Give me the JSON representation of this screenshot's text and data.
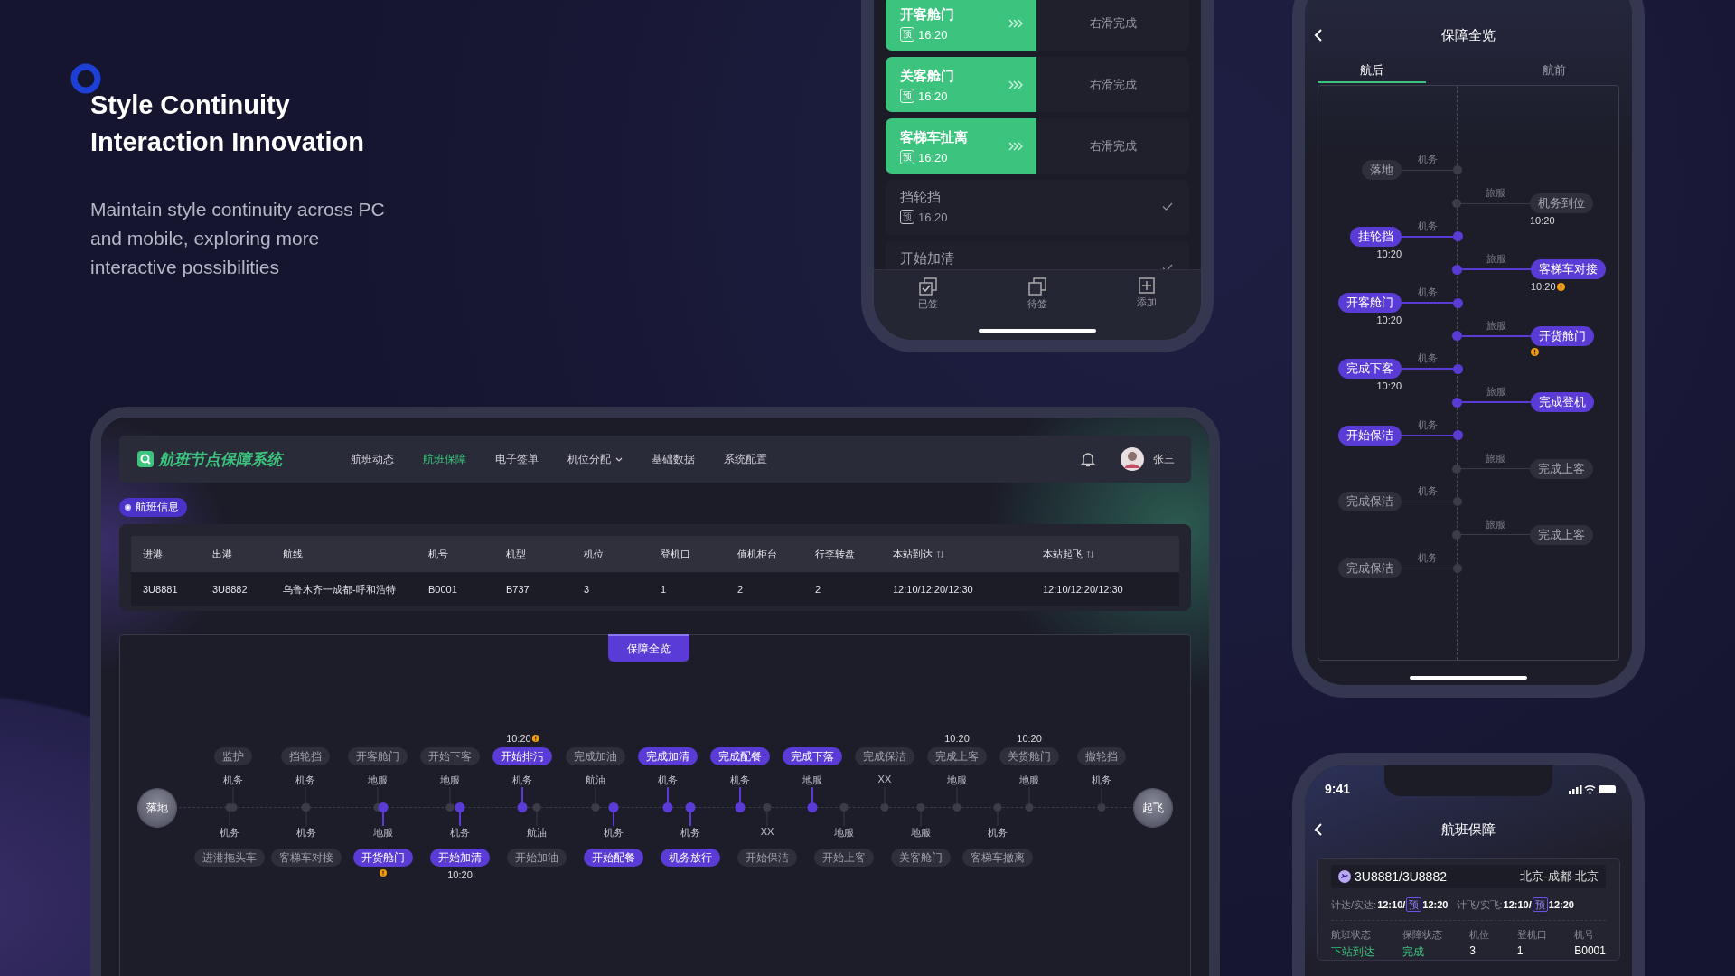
{
  "intro": {
    "heading": [
      "Style Continuity",
      "Interaction Innovation"
    ],
    "description": "Maintain style continuity across PC and mobile, exploring more interactive possibilities"
  },
  "task_phone": {
    "tasks": [
      {
        "kind": "swipe",
        "name": "开客舱门",
        "pre": "预",
        "time": "16:20",
        "action": "右滑完成"
      },
      {
        "kind": "swipe",
        "name": "关客舱门",
        "pre": "预",
        "time": "16:20",
        "action": "右滑完成"
      },
      {
        "kind": "swipe",
        "name": "客梯车扯离",
        "pre": "预",
        "time": "16:20",
        "action": "右滑完成"
      },
      {
        "kind": "done",
        "name": "挡轮挡",
        "pre": "预",
        "time": "16:20"
      },
      {
        "kind": "done",
        "name": "开始加清"
      }
    ],
    "tab_bar": [
      {
        "kind": "signed",
        "label": "已签"
      },
      {
        "kind": "pending",
        "label": "待签"
      },
      {
        "kind": "add",
        "label": "添加"
      }
    ]
  },
  "overview_phone": {
    "title": "保障全览",
    "tabs": [
      {
        "label": "航后",
        "selected": true
      },
      {
        "label": "航前",
        "selected": false
      }
    ],
    "events": [
      {
        "kind": "left",
        "label": "落地",
        "role": "机务",
        "active": false,
        "warning": false
      },
      {
        "kind": "right",
        "label": "机务到位",
        "role": "旅服",
        "active": false,
        "time": "10:20",
        "warning": false
      },
      {
        "kind": "left",
        "label": "挂轮挡",
        "role": "机务",
        "active": true,
        "time": "10:20",
        "warning": false
      },
      {
        "kind": "right",
        "label": "客梯车对接",
        "role": "旅服",
        "active": true,
        "time": "10:20",
        "warning": true
      },
      {
        "kind": "left",
        "label": "开客舱门",
        "role": "机务",
        "active": true,
        "time": "10:20",
        "warning": false
      },
      {
        "kind": "right",
        "label": "开货舱门",
        "role": "旅服",
        "active": true,
        "warning": true
      },
      {
        "kind": "left",
        "label": "完成下客",
        "role": "机务",
        "active": true,
        "time": "10:20",
        "warning": false
      },
      {
        "kind": "right",
        "label": "完成登机",
        "role": "旅服",
        "active": true,
        "warning": false
      },
      {
        "kind": "left",
        "label": "开始保洁",
        "role": "机务",
        "active": true,
        "warning": false
      },
      {
        "kind": "right",
        "label": "完成上客",
        "role": "旅服",
        "active": false,
        "warning": false
      },
      {
        "kind": "left",
        "label": "完成保洁",
        "role": "机务",
        "active": false,
        "warning": false
      },
      {
        "kind": "right",
        "label": "完成上客",
        "role": "旅服",
        "active": false,
        "warning": false
      },
      {
        "kind": "left",
        "label": "完成保洁",
        "role": "机务",
        "active": false,
        "warning": false
      }
    ]
  },
  "flight_phone": {
    "time": "9:41",
    "title": "航班保障",
    "flight": {
      "number": "3U8881/3U8882",
      "route": "北京-成都-北京"
    },
    "times": [
      {
        "label": "计达/实达:",
        "actual": "12:10/",
        "pre": "预",
        "planned": "12:20"
      },
      {
        "label": "计飞/实飞:",
        "actual": "12:10/",
        "pre": "预",
        "planned": "12:20"
      }
    ],
    "fields": [
      {
        "label": "航班状态",
        "value": "下站到达",
        "highlight": true
      },
      {
        "label": "保障状态",
        "value": "完成",
        "highlight": true
      },
      {
        "label": "机位",
        "value": "3",
        "highlight": false
      },
      {
        "label": "登机口",
        "value": "1",
        "highlight": false
      },
      {
        "label": "机号",
        "value": "B0001",
        "highlight": false
      }
    ]
  },
  "desktop": {
    "app_name": "航班节点保障系统",
    "nav": [
      {
        "label": "航班动态",
        "selected": false,
        "dropdown": false
      },
      {
        "label": "航班保障",
        "selected": true,
        "dropdown": false
      },
      {
        "label": "电子签单",
        "selected": false,
        "dropdown": false
      },
      {
        "label": "机位分配",
        "selected": false,
        "dropdown": true
      },
      {
        "label": "基础数据",
        "selected": false,
        "dropdown": false
      },
      {
        "label": "系统配置",
        "selected": false,
        "dropdown": false
      }
    ],
    "user": "张三",
    "section_tag": "航班信息",
    "table": {
      "columns": [
        {
          "label": "进港",
          "sortable": false
        },
        {
          "label": "出港",
          "sortable": false
        },
        {
          "label": "航线",
          "sortable": false
        },
        {
          "label": "机号",
          "sortable": false
        },
        {
          "label": "机型",
          "sortable": false
        },
        {
          "label": "机位",
          "sortable": false
        },
        {
          "label": "登机口",
          "sortable": false
        },
        {
          "label": "值机柜台",
          "sortable": false
        },
        {
          "label": "行李转盘",
          "sortable": false
        },
        {
          "label": "本站到达",
          "sortable": true
        },
        {
          "label": "本站起飞",
          "sortable": true
        }
      ],
      "rows": [
        [
          "3U8881",
          "3U8882",
          "乌鲁木齐一成都-呼和浩特",
          "B0001",
          "B737",
          "3",
          "1",
          "2",
          "2",
          "12:10/12:20/12:30",
          "12:10/12:20/12:30"
        ]
      ]
    },
    "overview_button": "保障全览",
    "start": "落地",
    "end": "起飞",
    "top_events": [
      {
        "label": "监护",
        "role": "机务",
        "active": false,
        "warning": false
      },
      {
        "label": "挡轮挡",
        "role": "机务",
        "active": false,
        "warning": false
      },
      {
        "label": "开客舱门",
        "role": "地服",
        "active": false,
        "warning": false
      },
      {
        "label": "开始下客",
        "role": "地服",
        "active": false,
        "warning": false
      },
      {
        "label": "开始排污",
        "role": "机务",
        "active": true,
        "time": "10:20",
        "warning": true
      },
      {
        "label": "完成加油",
        "role": "航油",
        "active": false,
        "warning": false
      },
      {
        "label": "完成加清",
        "role": "机务",
        "active": true,
        "warning": false
      },
      {
        "label": "完成配餐",
        "role": "机务",
        "active": true,
        "warning": false
      },
      {
        "label": "完成下落",
        "role": "地服",
        "active": true,
        "warning": false
      },
      {
        "label": "完成保洁",
        "role": "XX",
        "active": false,
        "warning": false
      },
      {
        "label": "完成上客",
        "role": "地服",
        "active": false,
        "time": "10:20",
        "warning": false
      },
      {
        "label": "关货舱门",
        "role": "地服",
        "active": false,
        "time": "10:20",
        "warning": false
      },
      {
        "label": "撤轮挡",
        "role": "机务",
        "active": false,
        "warning": false
      }
    ],
    "bottom_events": [
      {
        "label": "进港拖头车",
        "role": "机务",
        "active": false,
        "warning": false
      },
      {
        "label": "客梯车对接",
        "role": "机务",
        "active": false,
        "warning": false
      },
      {
        "label": "开货舱门",
        "role": "地服",
        "active": true,
        "warning": true
      },
      {
        "label": "开始加清",
        "role": "机务",
        "active": true,
        "time": "10:20",
        "warning": false
      },
      {
        "label": "开始加油",
        "role": "航油",
        "active": false,
        "warning": false
      },
      {
        "label": "开始配餐",
        "role": "机务",
        "active": true,
        "warning": false
      },
      {
        "label": "机务放行",
        "role": "机务",
        "active": true,
        "warning": false
      },
      {
        "label": "开始保洁",
        "role": "XX",
        "active": false,
        "warning": false
      },
      {
        "label": "开始上客",
        "role": "地服",
        "active": false,
        "warning": false
      },
      {
        "label": "关客舱门",
        "role": "地服",
        "active": false,
        "warning": false
      },
      {
        "label": "客梯车撤离",
        "role": "机务",
        "active": false,
        "warning": false
      }
    ]
  }
}
